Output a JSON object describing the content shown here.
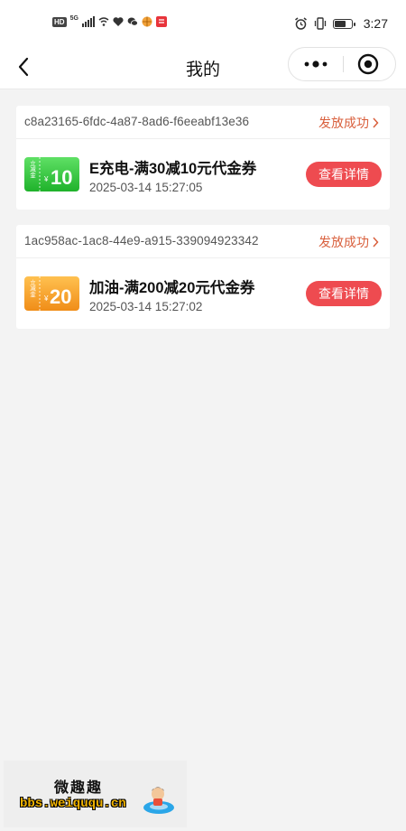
{
  "status_bar": {
    "hd": "HD",
    "network": "5G",
    "time": "3:27",
    "icons": [
      "signal-icon",
      "wifi-icon",
      "heart-app-icon",
      "wechat-icon",
      "ball-app-icon",
      "red-app-icon",
      "alarm-icon",
      "vibrate-icon",
      "battery-icon"
    ]
  },
  "nav": {
    "title": "我的",
    "back_icon": "chevron-left-icon",
    "more_icon": "more-dots-icon",
    "close_icon": "target-close-icon"
  },
  "orders": [
    {
      "order_id": "c8a23165-6fdc-4a87-8ad6-f6eeabf13e36",
      "status": "发放成功",
      "coupon": {
        "badge_text": "立减金",
        "currency": "¥",
        "amount": "10",
        "badge_color": "#2fc93c",
        "name": "E充电-满30减10元代金券",
        "time": "2025-03-14 15:27:05"
      },
      "detail_label": "查看详情"
    },
    {
      "order_id": "1ac958ac-1ac8-44e9-a915-339094923342",
      "status": "发放成功",
      "coupon": {
        "badge_text": "立减金",
        "currency": "¥",
        "amount": "20",
        "badge_color": "#f6a12a",
        "name": "加油-满200减20元代金券",
        "time": "2025-03-14 15:27:02"
      },
      "detail_label": "查看详情"
    }
  ],
  "watermark": {
    "line1": "微趣趣",
    "line2": "bbs.weiququ.cn"
  },
  "colors": {
    "accent_red": "#ee4b50",
    "status_orange": "#d95f3c",
    "background": "#f3f3f3"
  }
}
